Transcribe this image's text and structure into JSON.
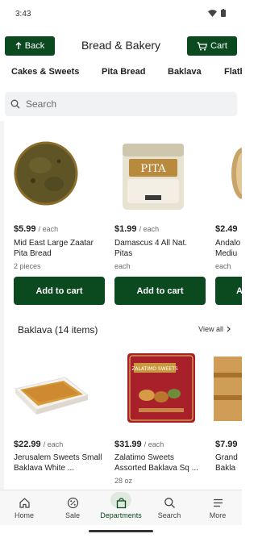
{
  "status_bar": {
    "time": "3:43"
  },
  "header": {
    "back_label": "Back",
    "title": "Bread & Bakery",
    "cart_label": "Cart"
  },
  "tabs": [
    {
      "label": "Cakes & Sweets"
    },
    {
      "label": "Pita Bread"
    },
    {
      "label": "Baklava"
    },
    {
      "label": "Flatb"
    }
  ],
  "search": {
    "placeholder": "Search"
  },
  "pita_section": {
    "products": [
      {
        "price": "$5.99",
        "unit": "/ each",
        "name": "Mid East Large Zaatar Pita Bread",
        "detail": "2 pieces",
        "button": "Add to cart"
      },
      {
        "price": "$1.99",
        "unit": "/ each",
        "name": "Damascus 4 All Nat. Pitas",
        "detail": "each",
        "button": "Add to cart"
      },
      {
        "price": "$2.49",
        "unit": "",
        "name": "Andalo Mediu",
        "detail": "each",
        "button": "A"
      }
    ]
  },
  "baklava_section": {
    "title": "Baklava (14 items)",
    "view_all": "View all",
    "products": [
      {
        "price": "$22.99",
        "unit": "/ each",
        "name": "Jerusalem Sweets Small Baklava White ...",
        "detail": ""
      },
      {
        "price": "$31.99",
        "unit": "/ each",
        "name": "Zalatimo Sweets Assorted Baklava Sq ...",
        "detail": "28 oz"
      },
      {
        "price": "$7.99",
        "unit": "",
        "name": "Grand Bakla",
        "detail": ""
      }
    ]
  },
  "bottom_nav": [
    {
      "label": "Home",
      "icon": "home-icon"
    },
    {
      "label": "Sale",
      "icon": "sale-icon"
    },
    {
      "label": "Departments",
      "icon": "departments-icon"
    },
    {
      "label": "Search",
      "icon": "search-icon"
    },
    {
      "label": "More",
      "icon": "more-icon"
    }
  ],
  "colors": {
    "brand_green": "#0b4a1f"
  }
}
